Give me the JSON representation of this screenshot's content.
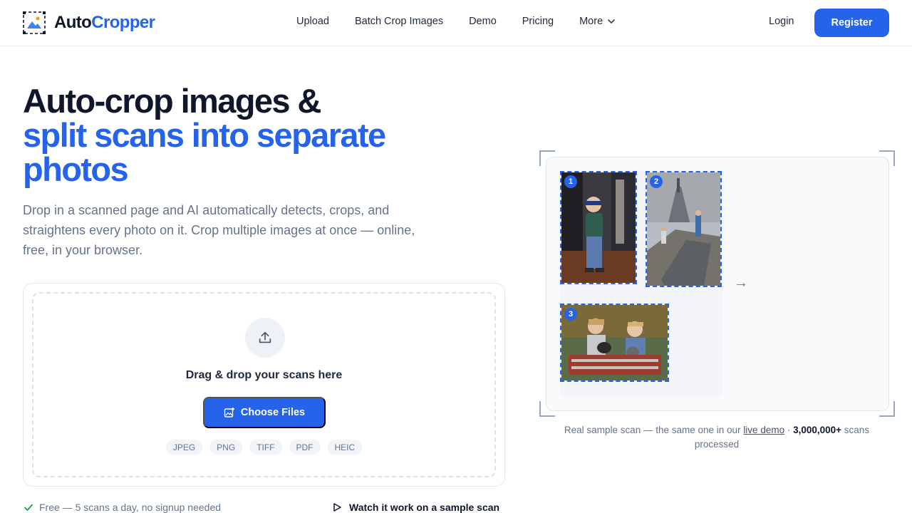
{
  "brand": {
    "part1": "Auto",
    "part2": "Cropper"
  },
  "nav": {
    "links": [
      "Upload",
      "Batch Crop Images",
      "Demo",
      "Pricing",
      "More"
    ],
    "login": "Login",
    "register": "Register"
  },
  "hero": {
    "title_line1": "Auto-crop images &",
    "title_line2": "split scans into separate",
    "title_line3": "photos",
    "subtitle": "Drop in a scanned page and AI automatically detects, crops, and straightens every photo on it. Crop multiple images at once — online, free, in your browser."
  },
  "upload": {
    "drag_text": "Drag & drop your scans here",
    "choose_label": "Choose Files",
    "formats": [
      "JPEG",
      "PNG",
      "TIFF",
      "PDF",
      "HEIC"
    ],
    "free_note": "Free — 5 scans a day, no signup needed",
    "watch_label": "Watch it work on a sample scan"
  },
  "preview": {
    "badges": [
      "1",
      "2",
      "3"
    ],
    "arrow": "→",
    "caption_pre": "Real sample scan — the same one in our ",
    "caption_link": "live demo",
    "caption_mid": " · ",
    "caption_count": "3,000,000+",
    "caption_post": " scans processed"
  },
  "colors": {
    "accent": "#2563eb",
    "text": "#0f172a",
    "muted": "#64748b"
  }
}
